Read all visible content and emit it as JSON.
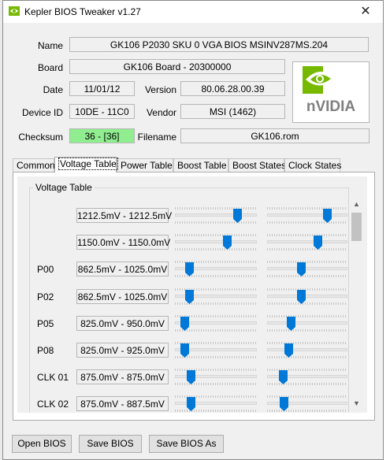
{
  "window": {
    "title": "Kepler BIOS Tweaker v1.27",
    "close_glyph": "✕"
  },
  "info": {
    "name_label": "Name",
    "name_value": "GK106 P2030 SKU 0 VGA BIOS MSINV287MS.204",
    "board_label": "Board",
    "board_value": "GK106 Board - 20300000",
    "date_label": "Date",
    "date_value": "11/01/12",
    "version_label": "Version",
    "version_value": "80.06.28.00.39",
    "device_label": "Device ID",
    "device_value": "10DE - 11C0",
    "vendor_label": "Vendor",
    "vendor_value": "MSI (1462)",
    "checksum_label": "Checksum",
    "checksum_value": "36 - [36]",
    "filename_label": "Filename",
    "filename_value": "GK106.rom",
    "checksum_color": "#90ee90"
  },
  "logo": {
    "brand": "nVIDIA",
    "accent": "#76b900"
  },
  "tabs": [
    "Common",
    "Voltage Table",
    "Power Table",
    "Boost Table",
    "Boost States",
    "Clock States"
  ],
  "active_tab": "Voltage Table",
  "voltage_table": {
    "title": "Voltage Table",
    "rows": [
      {
        "label": "",
        "value": "1212.5mV - 1212.5mV",
        "slider_min": 0.8,
        "slider_max": 0.78
      },
      {
        "label": "",
        "value": "1150.0mV - 1150.0mV",
        "slider_min": 0.66,
        "slider_max": 0.65
      },
      {
        "label": "P00",
        "value": "862.5mV - 1025.0mV",
        "slider_min": 0.14,
        "slider_max": 0.42
      },
      {
        "label": "P02",
        "value": "862.5mV - 1025.0mV",
        "slider_min": 0.14,
        "slider_max": 0.42
      },
      {
        "label": "P05",
        "value": "825.0mV - 950.0mV",
        "slider_min": 0.07,
        "slider_max": 0.28
      },
      {
        "label": "P08",
        "value": "825.0mV - 925.0mV",
        "slider_min": 0.07,
        "slider_max": 0.24
      },
      {
        "label": "CLK 01",
        "value": "875.0mV - 875.0mV",
        "slider_min": 0.16,
        "slider_max": 0.16
      },
      {
        "label": "CLK 02",
        "value": "875.0mV - 887.5mV",
        "slider_min": 0.16,
        "slider_max": 0.18
      }
    ],
    "thumb_color": "#0078d7"
  },
  "buttons": {
    "open": "Open BIOS",
    "save": "Save BIOS",
    "save_as": "Save BIOS As"
  }
}
